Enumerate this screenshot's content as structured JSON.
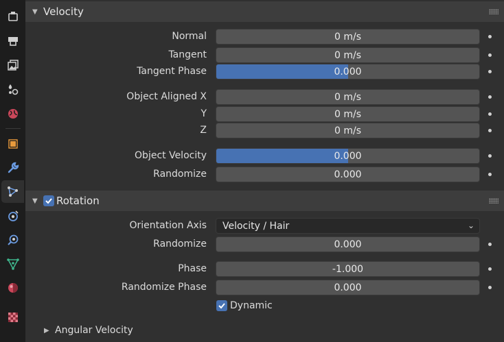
{
  "velocity_panel": {
    "title": "Velocity",
    "fields": [
      {
        "label": "Normal",
        "value": "0 m/s"
      },
      {
        "label": "Tangent",
        "value": "0 m/s"
      },
      {
        "label": "Tangent Phase",
        "value": "0.000",
        "fill_fraction": 0.5
      },
      {
        "label": "Object Aligned X",
        "value": "0 m/s"
      },
      {
        "label": "Y",
        "value": "0 m/s"
      },
      {
        "label": "Z",
        "value": "0 m/s"
      },
      {
        "label": "Object Velocity",
        "value": "0.000",
        "fill_fraction": 0.5
      },
      {
        "label": "Randomize",
        "value": "0.000"
      }
    ]
  },
  "rotation_panel": {
    "title": "Rotation",
    "enabled": true,
    "orientation_axis": {
      "label": "Orientation Axis",
      "value": "Velocity / Hair"
    },
    "randomize": {
      "label": "Randomize",
      "value": "0.000"
    },
    "phase": {
      "label": "Phase",
      "value": "-1.000"
    },
    "randomize_phase": {
      "label": "Randomize Phase",
      "value": "0.000"
    },
    "dynamic": {
      "label": "Dynamic",
      "checked": true
    }
  },
  "angular_velocity": {
    "title": "Angular Velocity"
  },
  "tabs": [
    {
      "name": "tool",
      "icon": "tool-icon"
    },
    {
      "name": "render",
      "icon": "printer-icon"
    },
    {
      "name": "output",
      "icon": "image-stack-icon"
    },
    {
      "name": "view-layer",
      "icon": "view-layer-icon"
    },
    {
      "name": "scene",
      "icon": "scene-icon"
    },
    {
      "name": "world",
      "icon": "world-icon"
    },
    {
      "name": "object",
      "icon": "object-icon"
    },
    {
      "name": "modifiers",
      "icon": "wrench-icon"
    },
    {
      "name": "particles",
      "icon": "particles-icon",
      "active": true
    },
    {
      "name": "physics",
      "icon": "physics-icon"
    },
    {
      "name": "constraints",
      "icon": "constraints-icon"
    },
    {
      "name": "data",
      "icon": "mesh-data-icon"
    },
    {
      "name": "material",
      "icon": "material-icon"
    },
    {
      "name": "texture",
      "icon": "texture-checker-icon"
    }
  ],
  "colors": {
    "accent": "#4772b3",
    "background": "#303030",
    "header": "#3d3d3d",
    "field": "#545454"
  }
}
